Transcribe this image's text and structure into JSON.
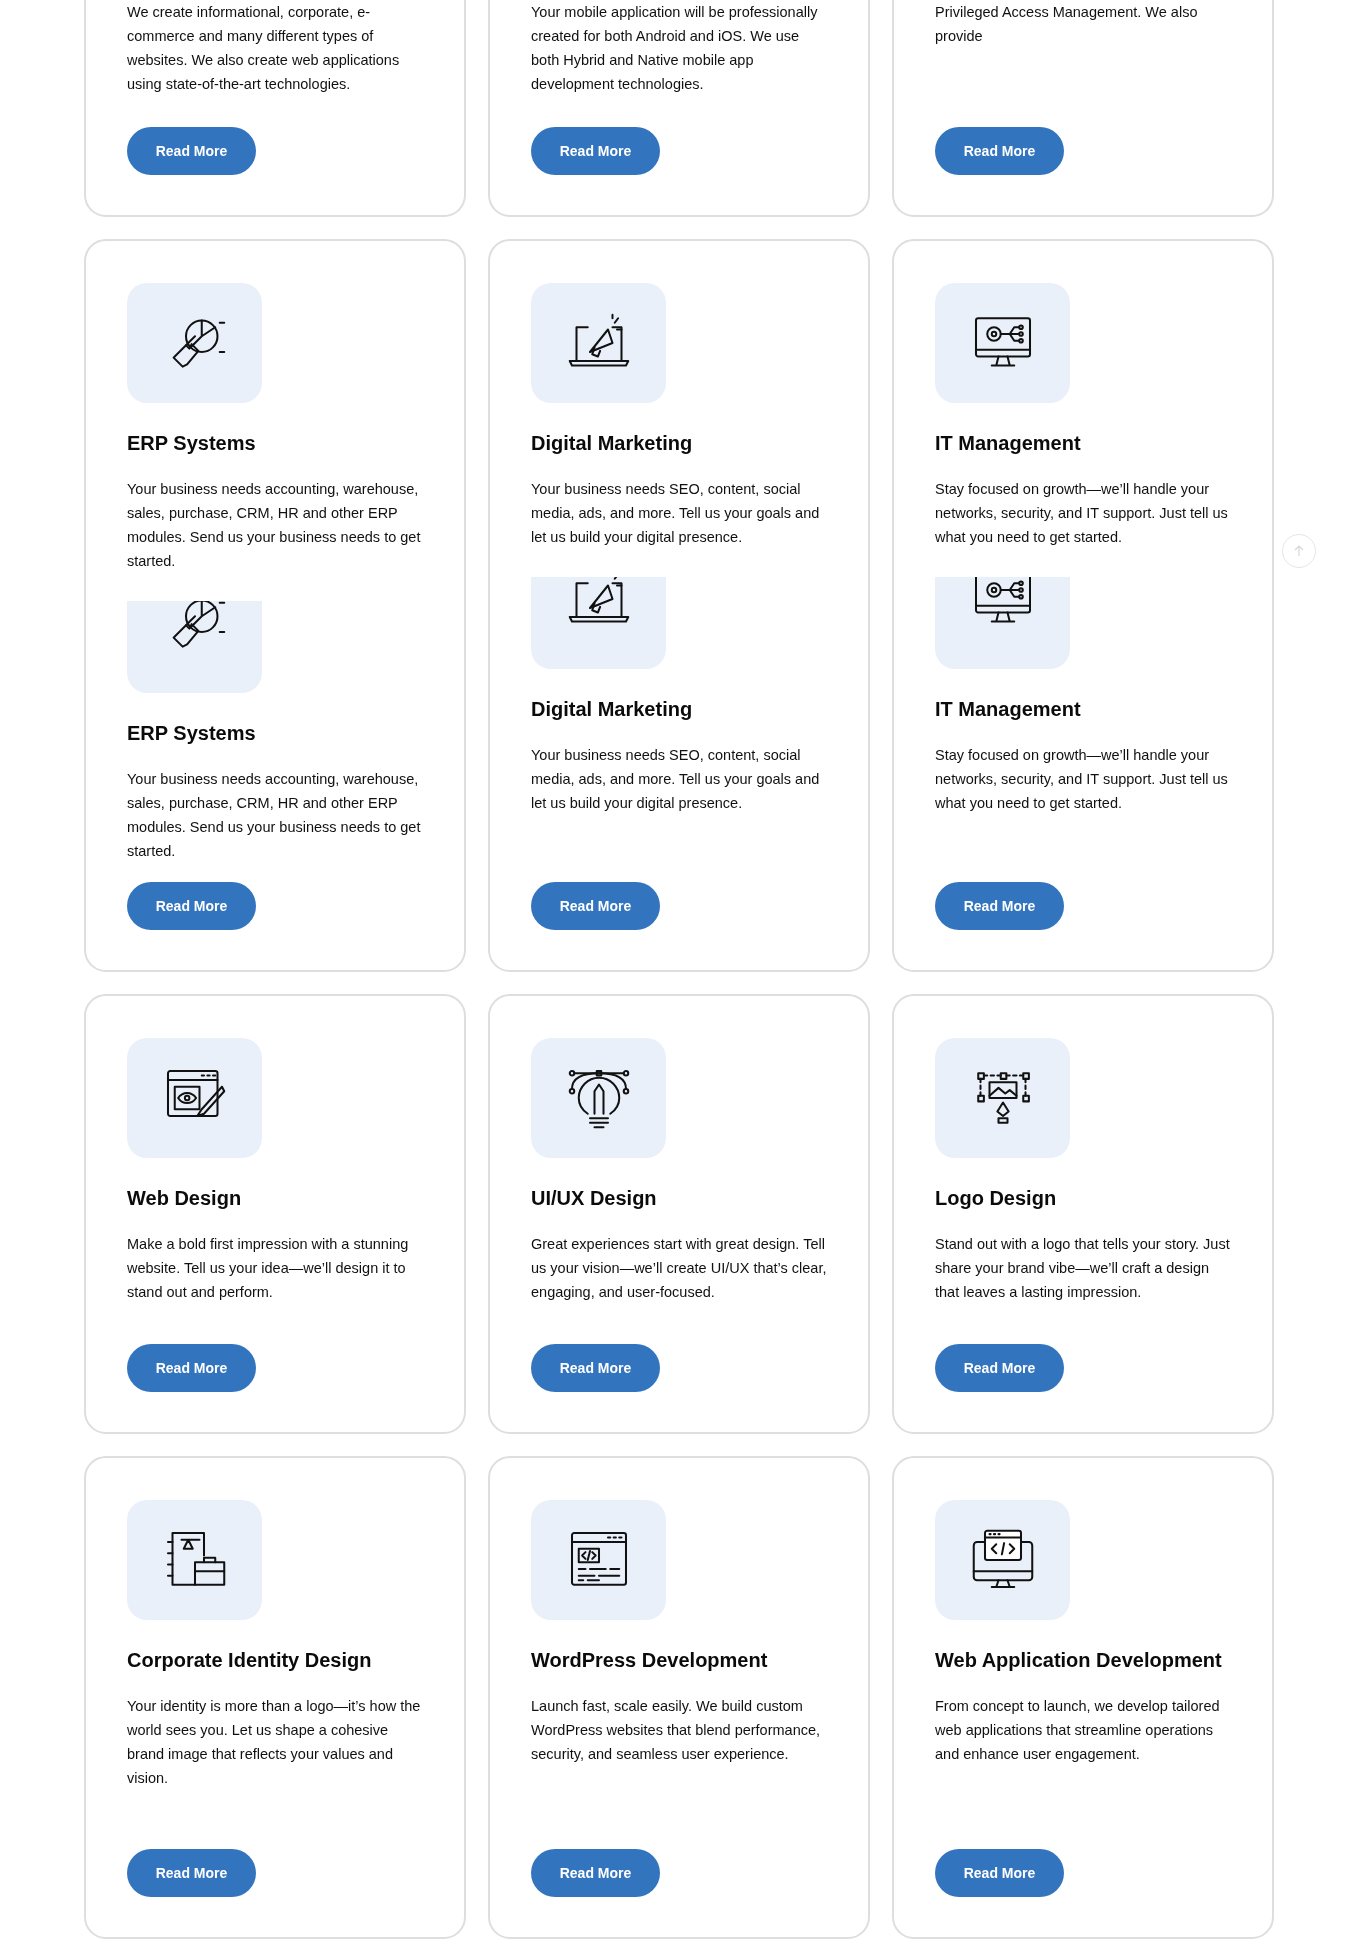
{
  "rows": [
    {
      "cards": [
        {
          "sections": [
            {
              "kind": "cut",
              "text": "We create informational, corporate, e-commerce and many different types of websites. We also create web applications using state-of-the-art technologies."
            }
          ],
          "button": "Read More"
        },
        {
          "sections": [
            {
              "kind": "cut",
              "text": "Your mobile application will be professionally created for both Android and iOS. We use both Hybrid and Native mobile app development technologies."
            }
          ],
          "button": "Read More"
        },
        {
          "sections": [
            {
              "kind": "cut",
              "text": "Privileged Access Management. We also provide"
            }
          ],
          "button": "Read More"
        }
      ]
    },
    {
      "cards": [
        {
          "sections": [
            {
              "kind": "full",
              "title": "ERP Systems",
              "text": "Your business needs accounting, warehouse, sales, purchase, CRM, HR and other ERP modules. Send us your business needs to get started."
            },
            {
              "kind": "clipped",
              "title": "ERP Systems",
              "text": "Your business needs accounting, warehouse, sales, purchase, CRM, HR and other ERP modules. Send us your business needs to get started."
            }
          ],
          "button": "Read More"
        },
        {
          "sections": [
            {
              "kind": "full",
              "title": "Digital Marketing",
              "text": "Your business needs SEO, content, social media, ads, and more. Tell us your goals and let us build your digital presence."
            },
            {
              "kind": "clipped",
              "title": "Digital Marketing",
              "text": "Your business needs SEO, content, social media, ads, and more. Tell us your goals and let us build your digital presence."
            }
          ],
          "button": "Read More"
        },
        {
          "sections": [
            {
              "kind": "full",
              "title": "IT Management",
              "text": "Stay focused on growth—we’ll handle your networks, security, and IT support. Just tell us what you need to get started."
            },
            {
              "kind": "clipped",
              "title": "IT Management",
              "text": "Stay focused on growth—we’ll handle your networks, security, and IT support. Just tell us what you need to get started."
            }
          ],
          "button": "Read More"
        }
      ]
    },
    {
      "cards": [
        {
          "sections": [
            {
              "kind": "full",
              "title": "Web Design",
              "text": "Make a bold first impression with a stunning website. Tell us your idea—we’ll design it to stand out and perform."
            }
          ],
          "button": "Read More"
        },
        {
          "sections": [
            {
              "kind": "full",
              "title": "UI/UX Design",
              "text": "Great experiences start with great design. Tell us your vision—we’ll create UI/UX that’s clear, engaging, and user-focused."
            }
          ],
          "button": "Read More"
        },
        {
          "sections": [
            {
              "kind": "full",
              "title": "Logo Design",
              "text": "Stand out with a logo that tells your story. Just share your brand vibe—we’ll craft a design that leaves a lasting impression."
            }
          ],
          "button": "Read More"
        }
      ]
    },
    {
      "cards": [
        {
          "sections": [
            {
              "kind": "full",
              "title": "Corporate Identity Design",
              "text": "Your identity is more than a logo—it’s how the world sees you. Let us shape a cohesive brand image that reflects your values and vision."
            }
          ],
          "button": "Read More"
        },
        {
          "sections": [
            {
              "kind": "full",
              "title": "WordPress Development",
              "text": "Launch fast, scale easily. We build custom WordPress websites that blend performance, security, and seamless user experience."
            }
          ],
          "button": "Read More"
        },
        {
          "sections": [
            {
              "kind": "full",
              "title": "Web Application Development",
              "text": "From concept to launch, we develop tailored web applications that streamline operations and enhance user engagement."
            }
          ],
          "button": "Read More"
        }
      ]
    }
  ]
}
